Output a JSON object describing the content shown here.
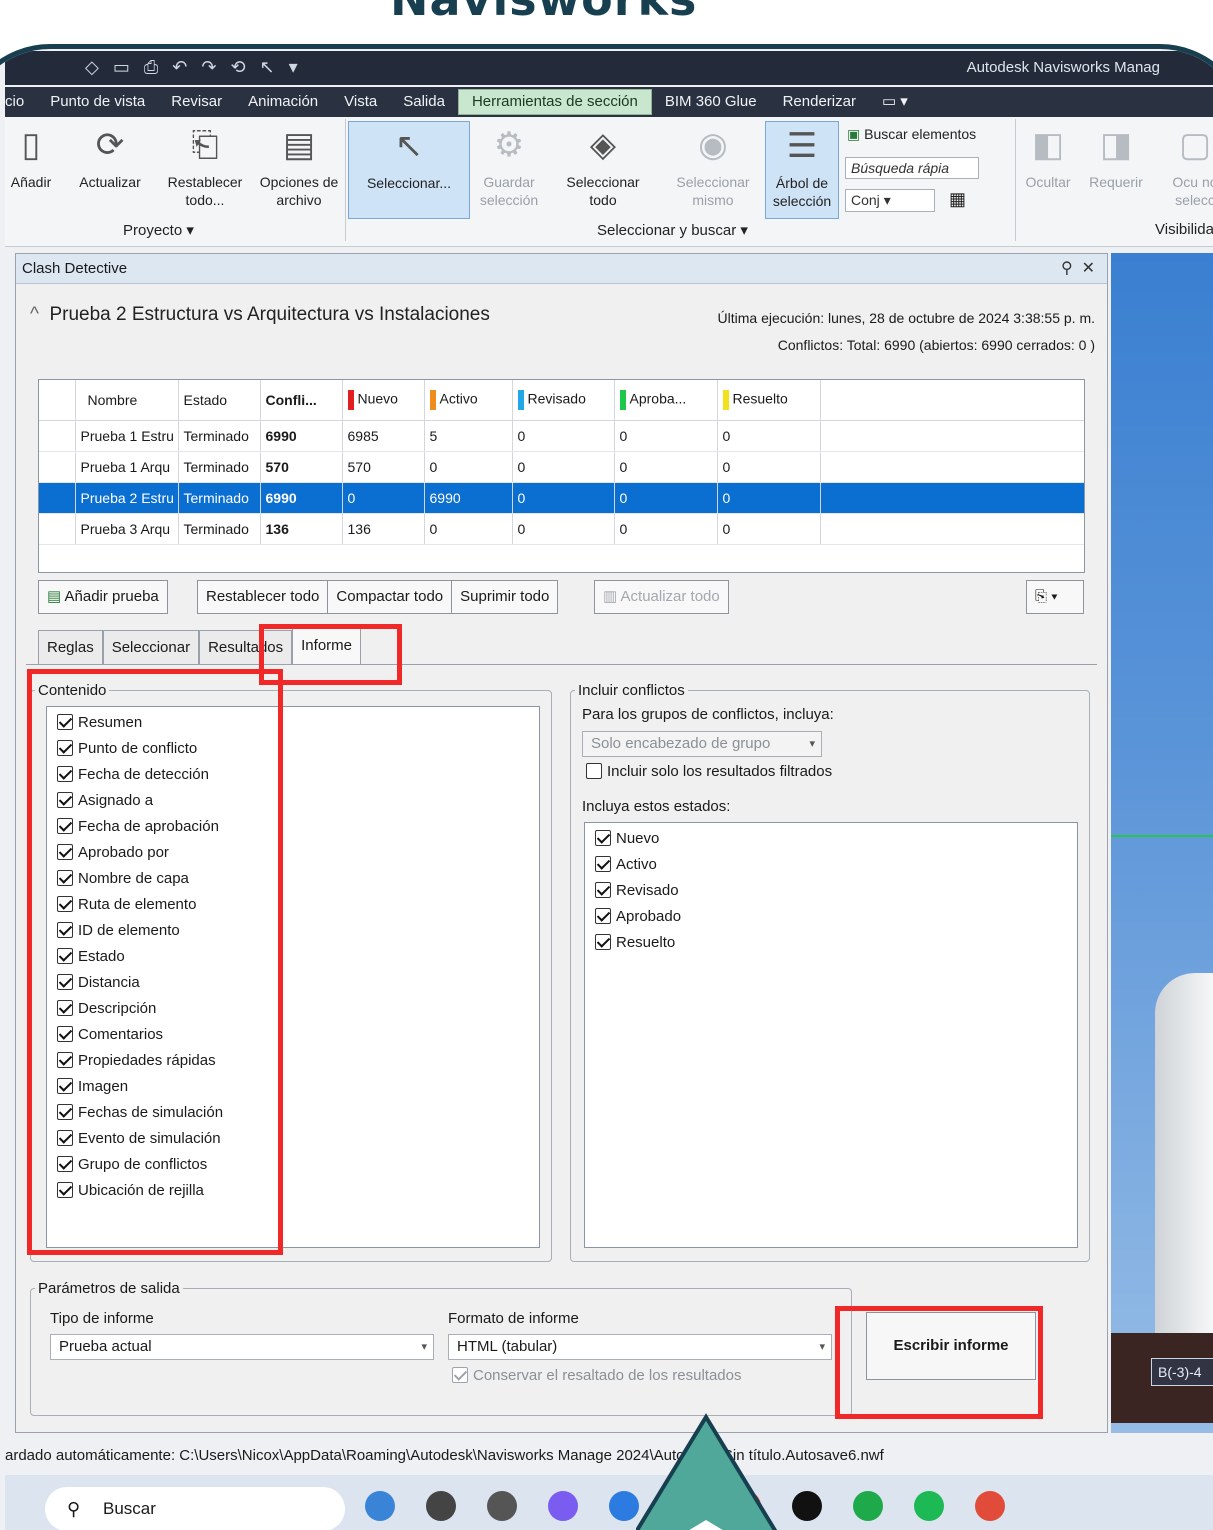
{
  "heading": "Navisworks",
  "window": {
    "title": "Autodesk Navisworks Manag",
    "quick_access": [
      "◇",
      "▭",
      "⎙",
      "↶",
      "↷",
      "⟲",
      "↖",
      "▾"
    ]
  },
  "menu": [
    "cio",
    "Punto de vista",
    "Revisar",
    "Animación",
    "Vista",
    "Salida",
    "Herramientas de sección",
    "BIM 360 Glue",
    "Renderizar",
    "▭ ▾"
  ],
  "ribbon": {
    "proyecto": {
      "label": "Proyecto ▾",
      "buttons": [
        "Añadir",
        "Actualizar",
        "Restablecer todo...",
        "Opciones de archivo"
      ]
    },
    "seleccionar": {
      "label": "Seleccionar y buscar ▾",
      "buttons": [
        "Seleccionar...",
        "Guardar selección",
        "Seleccionar todo",
        "Seleccionar mismo",
        "Árbol de selección"
      ],
      "buscar": "Buscar elementos",
      "busqueda": "Búsqueda rápia",
      "conj": "Conj"
    },
    "visibilidad": {
      "label": "Visibilida",
      "buttons": [
        "Ocultar",
        "Requerir",
        "Ocu no selecc"
      ]
    }
  },
  "panel": {
    "title": "Clash Detective",
    "test_name": "Prueba 2 Estructura vs Arquitectura vs Instalaciones",
    "last_run": "Última ejecución:  lunes, 28 de octubre de 2024 3:38:55 p. m.",
    "conflicts": "Conflictos: Total:  6990  (abiertos:  6990  cerrados:  0 )"
  },
  "grid": {
    "headers": [
      "Nombre",
      "Estado",
      "Confli...",
      "Nuevo",
      "Activo",
      "Revisado",
      "Aproba...",
      "Resuelto"
    ],
    "status_colors": [
      "#e02020",
      "#f08c1c",
      "#21a8e6",
      "#1ec84a",
      "#f2e21c"
    ],
    "rows": [
      [
        "Prueba 1 Estru",
        "Terminado",
        "6990",
        "6985",
        "5",
        "0",
        "0",
        "0"
      ],
      [
        "Prueba 1 Arqu",
        "Terminado",
        "570",
        "570",
        "0",
        "0",
        "0",
        "0"
      ],
      [
        "Prueba 2 Estru",
        "Terminado",
        "6990",
        "0",
        "6990",
        "0",
        "0",
        "0"
      ],
      [
        "Prueba 3 Arqu",
        "Terminado",
        "136",
        "136",
        "0",
        "0",
        "0",
        "0"
      ]
    ]
  },
  "actions": {
    "add_test": "Añadir prueba",
    "reset_all": "Restablecer todo",
    "compact_all": "Compactar todo",
    "delete_all": "Suprimir todo",
    "update_all": "Actualizar todo"
  },
  "tabs": [
    "Reglas",
    "Seleccionar",
    "Resultados",
    "Informe"
  ],
  "contenido": {
    "legend": "Contenido",
    "items": [
      "Resumen",
      "Punto de conflicto",
      "Fecha de detección",
      "Asignado a",
      "Fecha de aprobación",
      "Aprobado por",
      "Nombre de capa",
      "Ruta de elemento",
      "ID de elemento",
      "Estado",
      "Distancia",
      "Descripción",
      "Comentarios",
      "Propiedades rápidas",
      "Imagen",
      "Fechas de simulación",
      "Evento de simulación",
      "Grupo de conflictos",
      "Ubicación de rejilla"
    ]
  },
  "incluir": {
    "legend": "Incluir conflictos",
    "group_label": "Para los grupos de conflictos, incluya:",
    "group_value": "Solo encabezado de grupo",
    "filtered_only": "Incluir solo los resultados filtrados",
    "states_label": "Incluya estos estados:",
    "states": [
      "Nuevo",
      "Activo",
      "Revisado",
      "Aprobado",
      "Resuelto"
    ]
  },
  "salida": {
    "legend": "Parámetros de salida",
    "tipo_label": "Tipo de informe",
    "tipo_value": "Prueba actual",
    "formato_label": "Formato de informe",
    "formato_value": "HTML (tabular)",
    "preserve": "Conservar el resaltado de los resultados",
    "write_button": "Escribir informe"
  },
  "viewport": {
    "grid_label": "B(-3)-4"
  },
  "status": "ardado automáticamente: C:\\Users\\Nicox\\AppData\\Roaming\\Autodesk\\Navisworks Manage 2024\\AutoSave\\Sin título.Autosave6.nwf",
  "taskbar": {
    "search": "Buscar",
    "icon_colors": [
      "#3a84d8",
      "#444",
      "#555",
      "#7a5cf0",
      "#2c7be0",
      "#e8702a",
      "#e84b2c",
      "#111",
      "#1eaa4a",
      "#1db954",
      "#e04b3a"
    ]
  }
}
